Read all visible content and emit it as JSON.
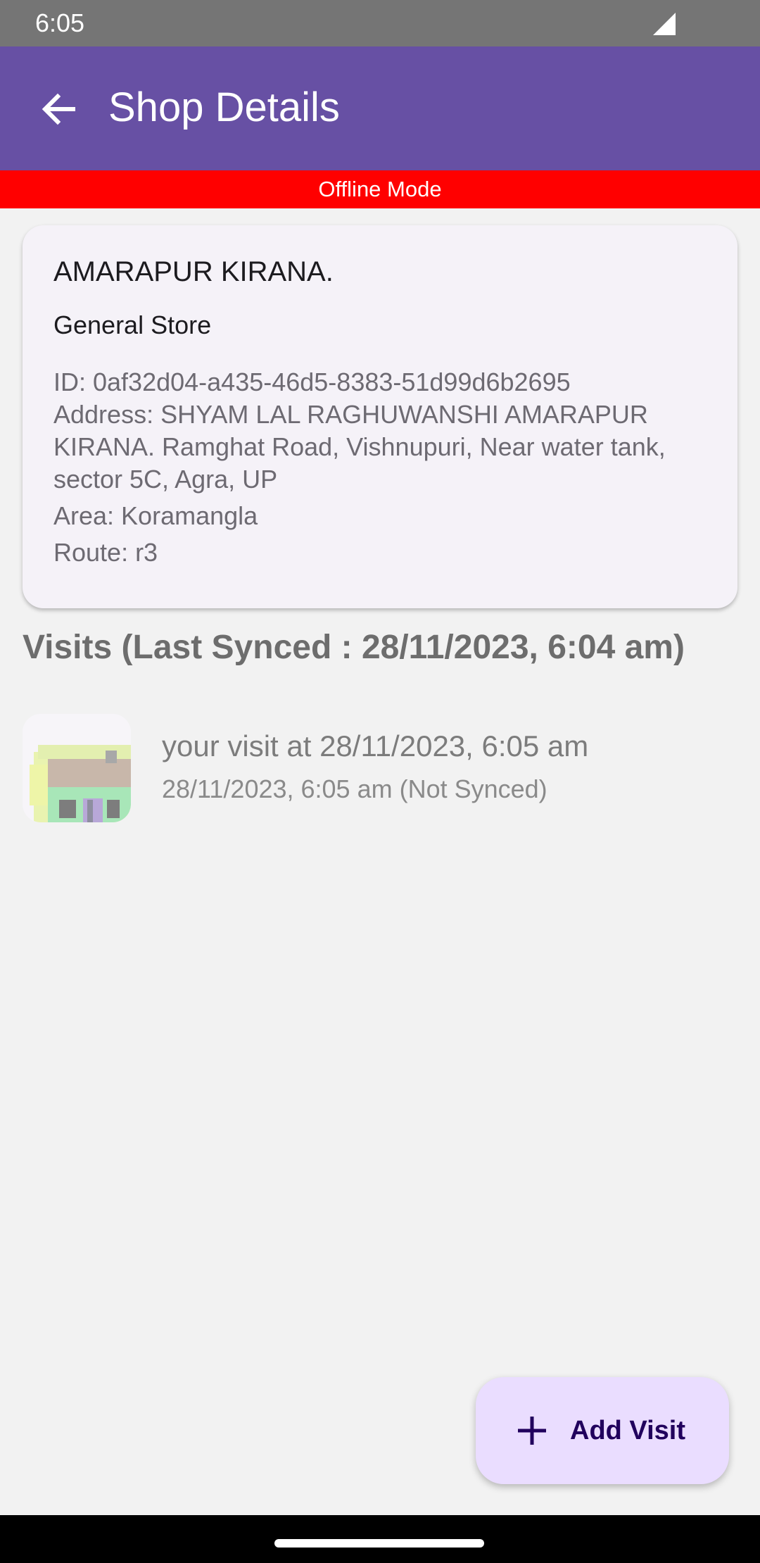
{
  "status": {
    "time": "6:05"
  },
  "appbar": {
    "title": "Shop Details"
  },
  "banner": {
    "text": "Offline Mode"
  },
  "shop": {
    "name": "AMARAPUR KIRANA.",
    "category": "General Store",
    "id": "ID: 0af32d04-a435-46d5-8383-51d99d6b2695",
    "address": "Address: SHYAM LAL RAGHUWANSHI AMARAPUR KIRANA. Ramghat Road, Vishnupuri, Near water tank, sector 5C, Agra, UP",
    "area": "Area: Koramangla",
    "route": "Route: r3"
  },
  "visits": {
    "header": "Visits (Last Synced : 28/11/2023, 6:04 am)",
    "items": [
      {
        "title": "your visit at 28/11/2023, 6:05 am",
        "subtitle": "28/11/2023, 6:05 am (Not Synced)"
      }
    ]
  },
  "fab": {
    "label": "Add Visit",
    "icon": "plus-icon"
  },
  "colors": {
    "appbar": "#6750a4",
    "banner": "#ff0000",
    "fab": "#eaddff"
  }
}
